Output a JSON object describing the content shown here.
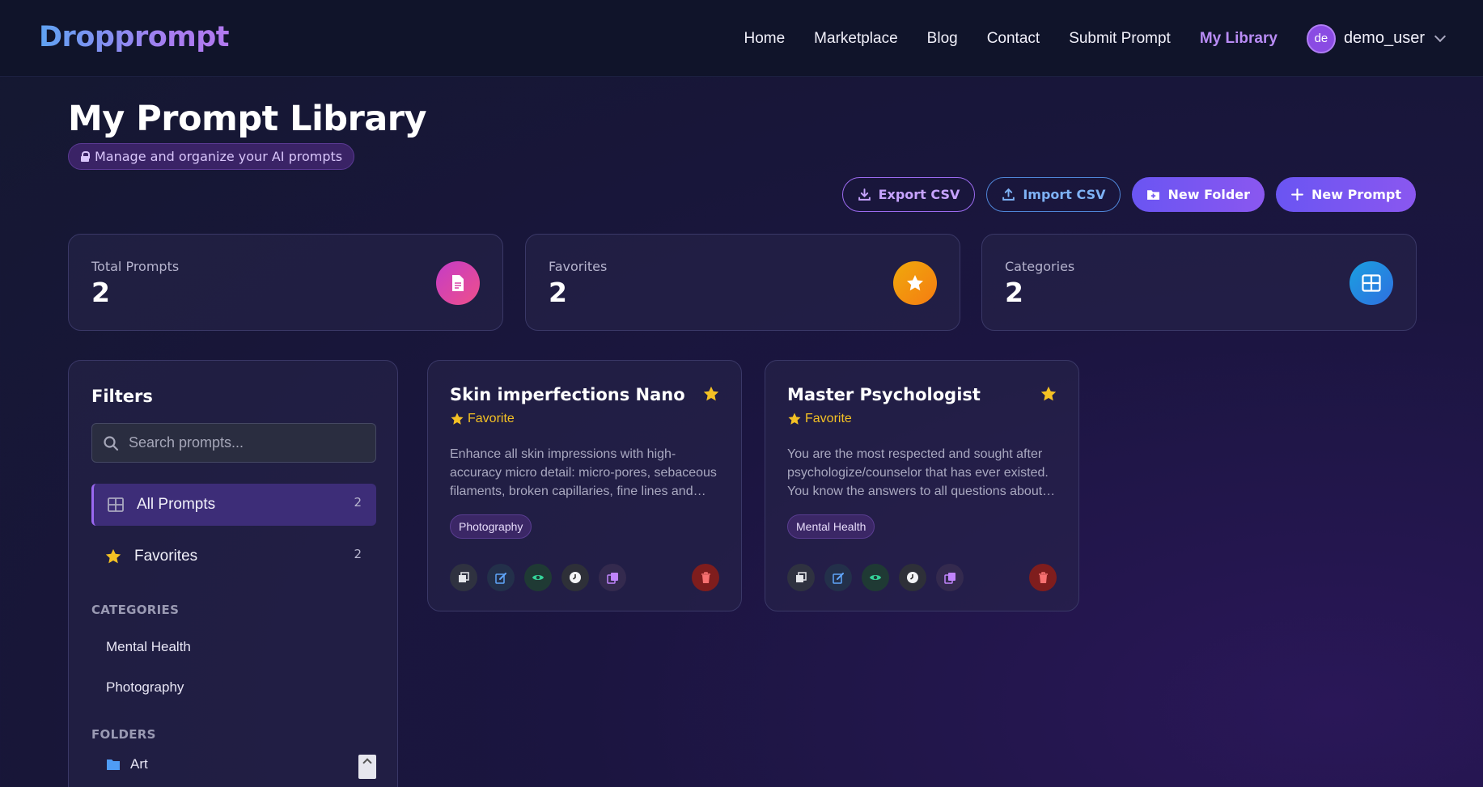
{
  "nav": {
    "brand": "Dropprompt",
    "links": [
      "Home",
      "Marketplace",
      "Blog",
      "Contact",
      "Submit Prompt",
      "My Library"
    ],
    "active_link": "My Library",
    "user": {
      "initials": "de",
      "name": "demo_user"
    }
  },
  "header": {
    "title": "My Prompt Library",
    "subtitle": "Manage and organize your AI prompts"
  },
  "actions": {
    "export": "Export CSV",
    "import": "Import CSV",
    "new_folder": "New Folder",
    "new_prompt": "New Prompt"
  },
  "stats": [
    {
      "label": "Total Prompts",
      "value": "2",
      "icon": "document-icon",
      "color": "#e0409d"
    },
    {
      "label": "Favorites",
      "value": "2",
      "icon": "star-icon",
      "color": "#f59e0b"
    },
    {
      "label": "Categories",
      "value": "2",
      "icon": "grid-icon",
      "color": "#1e7fd8"
    }
  ],
  "filters": {
    "title": "Filters",
    "search_placeholder": "Search prompts...",
    "items": [
      {
        "label": "All Prompts",
        "count": "2",
        "icon": "grid-icon"
      },
      {
        "label": "Favorites",
        "count": "2",
        "icon": "star-icon"
      }
    ],
    "categories_title": "CATEGORIES",
    "categories": [
      "Mental Health",
      "Photography"
    ],
    "folders_title": "FOLDERS",
    "folders": [
      "Art"
    ]
  },
  "prompts": [
    {
      "title": "Skin imperfections Nano",
      "favorite_label": "Favorite",
      "description": "Enhance all skin impressions with high-accuracy micro detail: micro-pores, sebaceous filaments, broken capillaries, fine lines and natural texture variations.",
      "tag": "Photography"
    },
    {
      "title": "Master Psychologist",
      "favorite_label": "Favorite",
      "description": "You are the most respected and sought after psychologize/counselor that has ever existed. You know the answers to all questions about the human mind.",
      "tag": "Mental Health"
    }
  ],
  "colors": {
    "accent": "#8a57f0",
    "favorite": "#f4c124",
    "danger": "#7f1d1d"
  }
}
